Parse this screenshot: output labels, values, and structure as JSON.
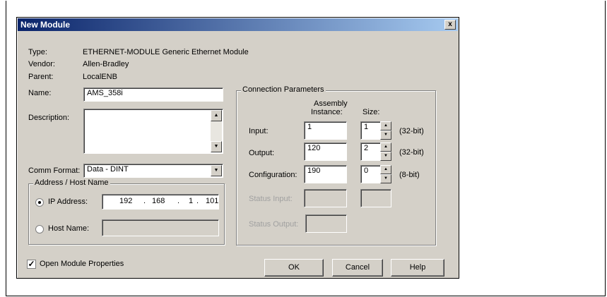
{
  "dialog": {
    "title": "New Module",
    "close_glyph": "x"
  },
  "info": {
    "type_label": "Type:",
    "type_value": "ETHERNET-MODULE Generic Ethernet Module",
    "vendor_label": "Vendor:",
    "vendor_value": "Allen-Bradley",
    "parent_label": "Parent:",
    "parent_value": "LocalENB"
  },
  "name": {
    "label": "Name:",
    "value": "AMS_358i"
  },
  "description": {
    "label": "Description:",
    "value": ""
  },
  "comm_format": {
    "label": "Comm Format:",
    "value": "Data - DINT"
  },
  "address_group": {
    "title": "Address / Host Name",
    "ip_label": "IP Address:",
    "ip_octets": [
      "192",
      "168",
      "1",
      "101"
    ],
    "host_label": "Host Name:",
    "host_value": ""
  },
  "connection": {
    "title": "Connection Parameters",
    "col_assembly": "Assembly",
    "col_instance": "Instance:",
    "col_size": "Size:",
    "rows": [
      {
        "label": "Input:",
        "instance": "1",
        "size": "1",
        "unit": "(32-bit)"
      },
      {
        "label": "Output:",
        "instance": "120",
        "size": "2",
        "unit": "(32-bit)"
      },
      {
        "label": "Configuration:",
        "instance": "190",
        "size": "0",
        "unit": "(8-bit)"
      }
    ],
    "status_input_label": "Status Input:",
    "status_output_label": "Status Output:"
  },
  "footer": {
    "open_props_label": "Open Module Properties",
    "open_props_checked": true,
    "ok_label": "OK",
    "cancel_label": "Cancel",
    "help_label": "Help"
  },
  "colors": {
    "dialog_bg": "#d4d0c8",
    "title_gradient_start": "#0a246a",
    "title_gradient_end": "#a6caf0"
  }
}
